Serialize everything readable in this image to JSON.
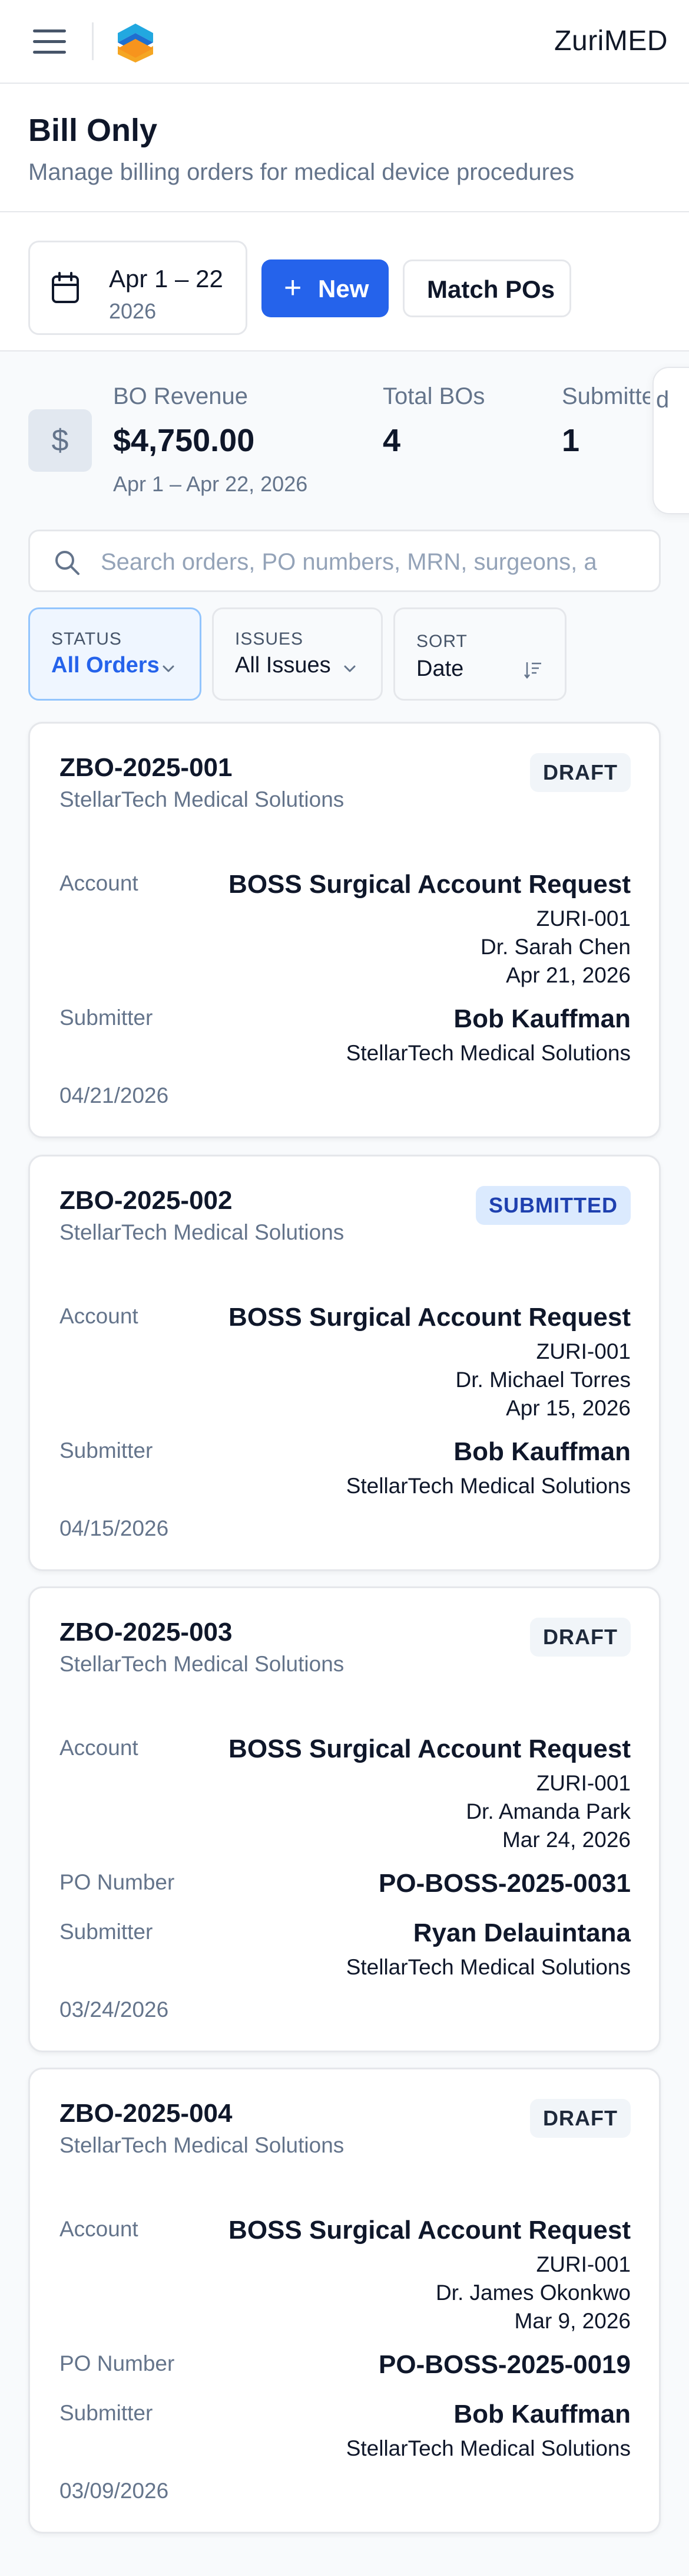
{
  "header": {
    "brand": "ZuriMED",
    "menu_icon": "hamburger-menu-icon",
    "logo_icon": "zurimed-logo-icon"
  },
  "page": {
    "title": "Bill Only",
    "subtitle": "Manage billing orders for medical device procedures"
  },
  "toolbar": {
    "date_range": "Apr 1 – 22",
    "date_year": "2026",
    "new_label": "New",
    "match_label": "Match POs"
  },
  "stats": {
    "revenue_label": "BO Revenue",
    "revenue_value": "$4,750.00",
    "revenue_note": "Apr 1 – Apr 22, 2026",
    "total_label": "Total BOs",
    "total_value": "4",
    "submitted_label": "Submitted",
    "submitted_value": "1",
    "overflow_label": "d"
  },
  "search": {
    "placeholder": "Search orders, PO numbers, MRN, surgeons, a"
  },
  "filters": {
    "status_caption": "STATUS",
    "status_value": "All Orders",
    "issues_caption": "ISSUES",
    "issues_value": "All Issues",
    "sort_caption": "SORT",
    "sort_value": "Date"
  },
  "labels": {
    "account": "Account",
    "po_number": "PO Number",
    "submitter": "Submitter"
  },
  "orders": [
    {
      "id": "ZBO-2025-001",
      "org": "StellarTech Medical Solutions",
      "status": "DRAFT",
      "account_name": "BOSS Surgical Account Request",
      "account_code": "ZURI-001",
      "surgeon": "Dr. Sarah Chen",
      "procedure_date": "Apr 21, 2026",
      "po_number": "",
      "submitter_name": "Bob Kauffman",
      "submitter_org": "StellarTech Medical Solutions",
      "date": "04/21/2026"
    },
    {
      "id": "ZBO-2025-002",
      "org": "StellarTech Medical Solutions",
      "status": "SUBMITTED",
      "account_name": "BOSS Surgical Account Request",
      "account_code": "ZURI-001",
      "surgeon": "Dr. Michael Torres",
      "procedure_date": "Apr 15, 2026",
      "po_number": "",
      "submitter_name": "Bob Kauffman",
      "submitter_org": "StellarTech Medical Solutions",
      "date": "04/15/2026"
    },
    {
      "id": "ZBO-2025-003",
      "org": "StellarTech Medical Solutions",
      "status": "DRAFT",
      "account_name": "BOSS Surgical Account Request",
      "account_code": "ZURI-001",
      "surgeon": "Dr. Amanda Park",
      "procedure_date": "Mar 24, 2026",
      "po_number": "PO-BOSS-2025-0031",
      "submitter_name": "Ryan Delauintana",
      "submitter_org": "StellarTech Medical Solutions",
      "date": "03/24/2026"
    },
    {
      "id": "ZBO-2025-004",
      "org": "StellarTech Medical Solutions",
      "status": "DRAFT",
      "account_name": "BOSS Surgical Account Request",
      "account_code": "ZURI-001",
      "surgeon": "Dr. James Okonkwo",
      "procedure_date": "Mar 9, 2026",
      "po_number": "PO-BOSS-2025-0019",
      "submitter_name": "Bob Kauffman",
      "submitter_org": "StellarTech Medical Solutions",
      "date": "03/09/2026"
    }
  ],
  "colors": {
    "primary": "#2563eb",
    "draft_badge_bg": "#f1f5f9",
    "submitted_badge_bg": "#dbeafe",
    "submitted_badge_text": "#1e40af"
  }
}
